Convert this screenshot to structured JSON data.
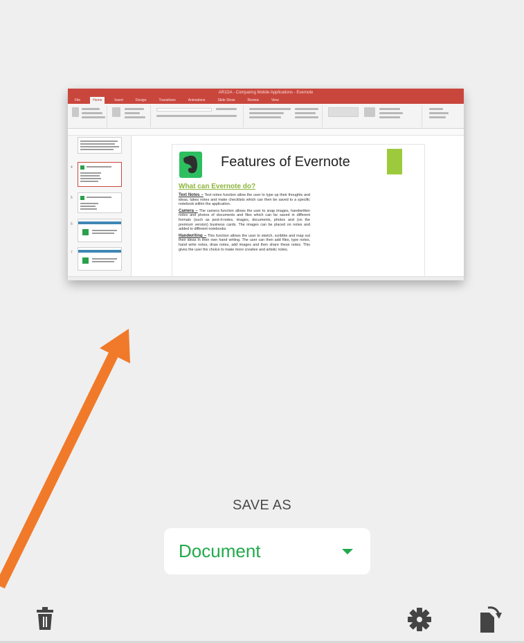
{
  "preview": {
    "window_title": "AR1DA - Comparing Mobile Applications - Evernote",
    "ribbon_tabs": [
      {
        "label": "File",
        "active": false
      },
      {
        "label": "Home",
        "active": true
      },
      {
        "label": "Insert",
        "active": false
      },
      {
        "label": "Design",
        "active": false
      },
      {
        "label": "Transitions",
        "active": false
      },
      {
        "label": "Animations",
        "active": false
      },
      {
        "label": "Slide Show",
        "active": false
      },
      {
        "label": "Review",
        "active": false
      },
      {
        "label": "View",
        "active": false
      }
    ],
    "slide": {
      "title": "Features of Evernote",
      "subtitle": "What can Evernote do?",
      "paragraphs": [
        {
          "term": "Text Notes –",
          "text": " Text notes function allow the user to type up their thoughts and ideas, takes notes and make checklists which can then be saved to a specific notebook within the application."
        },
        {
          "term": "Camera –",
          "text": " The camera function allows the user to snap images, handwritten notes and photos of documents and files which can be saved in different formats (such as post-it-notes, images, documents, photos and (on the premium version) business cards. The images can be placed on notes and added to different notebooks."
        },
        {
          "term": "Handwriting –",
          "text": " This function allows the user to sketch, scribble and map out their ideas in their own hand writing. The user can then add files, type notes, hand write notes, draw notes, add images and then share these notes. This gives the user the choice to make more creative and artistic notes."
        }
      ]
    },
    "colors": {
      "powerpoint_red": "#c9463d",
      "evernote_green": "#2dbe60",
      "accent_lime": "#9cca3c"
    }
  },
  "annotation": {
    "arrow_color": "#f07a2a"
  },
  "save_as": {
    "label": "SAVE AS",
    "selected_format": "Document",
    "accent_color": "#22a94b"
  },
  "toolbar": {
    "left_icon": "trash-icon",
    "right_icons": [
      "gear-icon",
      "rotate-icon"
    ]
  }
}
